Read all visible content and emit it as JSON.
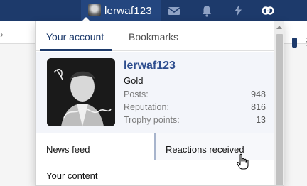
{
  "navbar": {
    "username": "lerwaf123",
    "icons": [
      "mail-icon",
      "bell-icon",
      "lightning-icon",
      "link-icon"
    ]
  },
  "menu": {
    "tabs": [
      {
        "label": "Your account"
      },
      {
        "label": "Bookmarks"
      }
    ],
    "profile": {
      "username": "lerwaf123",
      "user_title": "Gold",
      "stats": [
        {
          "label": "Posts:",
          "value": "948"
        },
        {
          "label": "Reputation:",
          "value": "816"
        },
        {
          "label": "Trophy points:",
          "value": "13"
        }
      ]
    },
    "links": {
      "news_feed": "News feed",
      "reactions_received": "Reactions received",
      "your_content": "Your content"
    }
  },
  "colors": {
    "navbar_bg": "#1d3a6b",
    "accent": "#2e4e8f",
    "profile_bg": "#f3f5fa"
  }
}
